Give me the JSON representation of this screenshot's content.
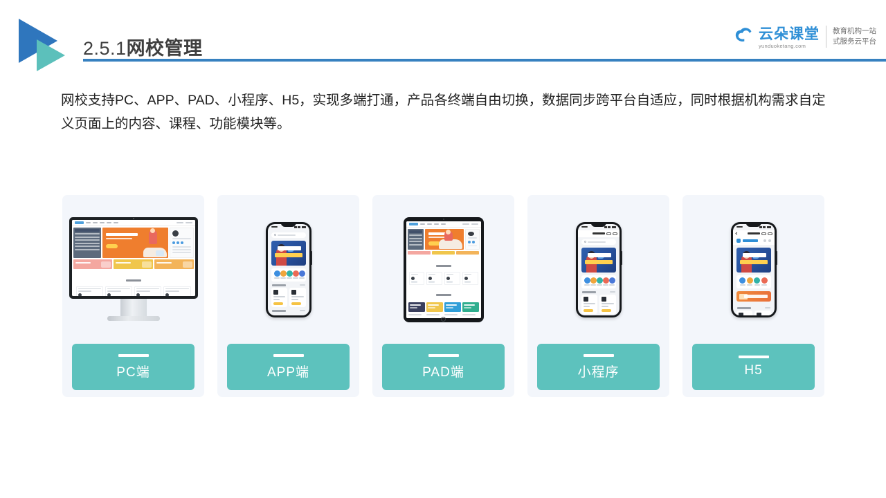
{
  "header": {
    "section_number": "2.5.1",
    "section_title": "网校管理",
    "rule_color": "#3781c0",
    "logo_arrow_blue": "#2f76bd",
    "logo_arrow_teal": "#5cc0bb"
  },
  "brand": {
    "name_cn": "云朵课堂",
    "domain": "yunduoketang.com",
    "tagline_line1": "教育机构一站",
    "tagline_line2": "式服务云平台",
    "color": "#2f8fd6"
  },
  "body": {
    "paragraph": "网校支持PC、APP、PAD、小程序、H5，实现多端打通，产品各终端自由切换，数据同步跨平台自适应，同时根据机构需求自定义页面上的内容、课程、功能模块等。"
  },
  "platforms": {
    "tag_color": "#5dc2bd",
    "card_bg": "#f3f6fb",
    "cards": [
      {
        "id": "pc",
        "label": "PC端",
        "device": "desktop-monitor"
      },
      {
        "id": "app",
        "label": "APP端",
        "device": "smartphone"
      },
      {
        "id": "pad",
        "label": "PAD端",
        "device": "tablet"
      },
      {
        "id": "mini",
        "label": "小程序",
        "device": "smartphone-miniprogram"
      },
      {
        "id": "h5",
        "label": "H5",
        "device": "smartphone-browser"
      }
    ]
  },
  "mockup": {
    "banner_line1": "职场人的",
    "banner_line2": "第一堂闪问课",
    "icon_colors": [
      "#3d8fe0",
      "#f0a63c",
      "#31b3a8",
      "#ea6a55",
      "#4a78d8"
    ],
    "pad_card_colors": [
      "#3a3f5e",
      "#f0c64c",
      "#2f9ed8",
      "#2fae8e",
      "#3a4a7e",
      "#ef8434",
      "#394b63",
      "#4a8fd0",
      "#f0c64c",
      "#2f8fd6",
      "#2fae8e",
      "#ef8434"
    ]
  }
}
